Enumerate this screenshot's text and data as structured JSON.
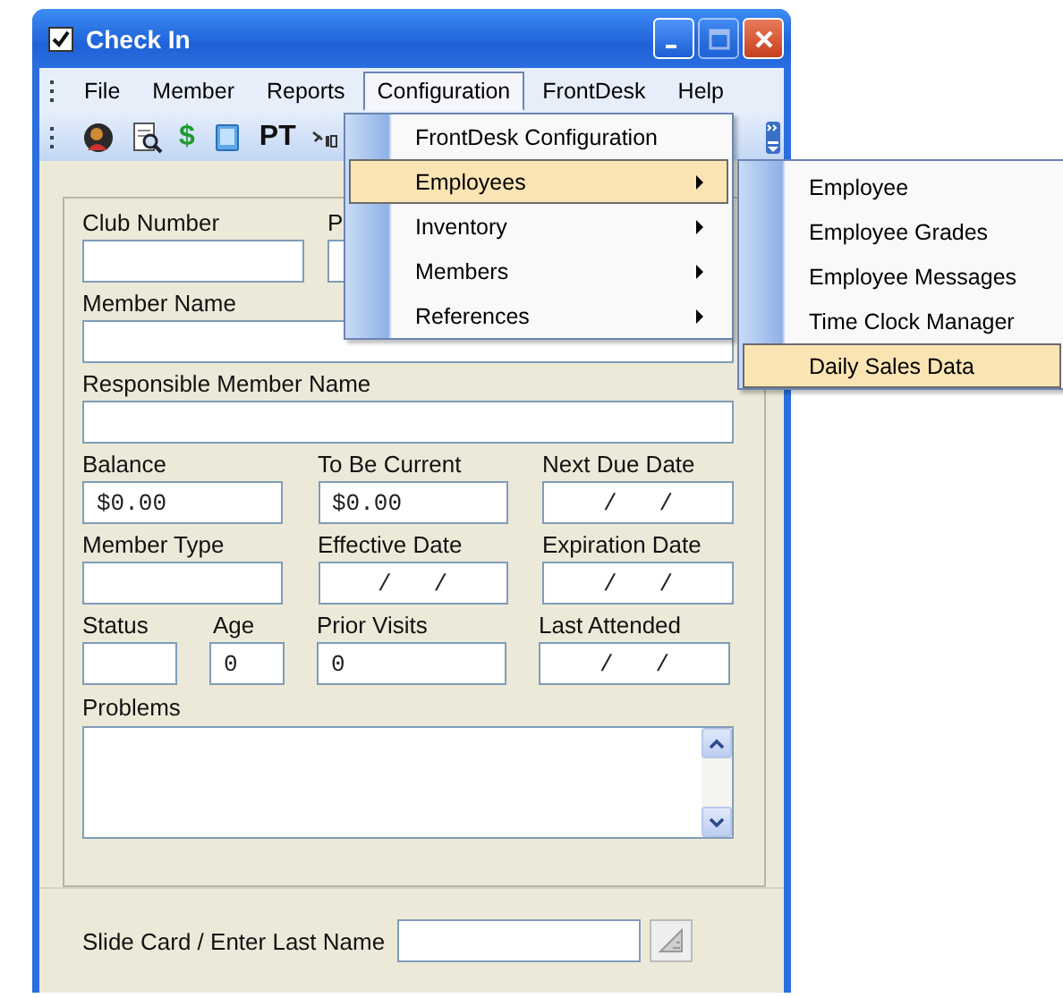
{
  "window": {
    "title": "Check In",
    "buttons": [
      {
        "kind": "minimize",
        "disabled": false
      },
      {
        "kind": "maximize",
        "disabled": true
      },
      {
        "kind": "close",
        "disabled": false
      }
    ]
  },
  "menu_bar": [
    {
      "label": "File",
      "selected": false
    },
    {
      "label": "Member",
      "selected": false
    },
    {
      "label": "Reports",
      "selected": false
    },
    {
      "label": "Configuration",
      "selected": true
    },
    {
      "label": "FrontDesk",
      "selected": false
    },
    {
      "label": "Help",
      "selected": false
    }
  ],
  "toolbar": [
    {
      "kind": "person"
    },
    {
      "kind": "document-search"
    },
    {
      "kind": "text",
      "label": "$",
      "color": "#1f9a2e"
    },
    {
      "kind": "document"
    },
    {
      "kind": "text",
      "label": "PT",
      "color": "#111111"
    },
    {
      "kind": "small"
    }
  ],
  "form_rows": [
    [
      {
        "label": "Club Number"
      },
      {
        "label": "P"
      }
    ],
    [
      {
        "label": "Member Name"
      }
    ],
    [
      {
        "label": "Responsible Member Name"
      }
    ],
    [
      {
        "label": "Balance",
        "value": "$0.00"
      },
      {
        "label": "To Be Current",
        "value": "$0.00"
      },
      {
        "label": "Next Due Date",
        "value": "/   /",
        "kind": "date"
      }
    ],
    [
      {
        "label": "Member Type"
      },
      {
        "label": "Effective Date",
        "value": "/   /",
        "kind": "date"
      },
      {
        "label": "Expiration Date",
        "value": "/   /",
        "kind": "date"
      }
    ],
    [
      {
        "label": "Status"
      },
      {
        "label": "Age",
        "value": "0"
      },
      {
        "label": "Prior Visits",
        "value": "0"
      },
      {
        "label": "Last Attended",
        "value": "/   /",
        "kind": "date"
      }
    ]
  ],
  "problems": {
    "label": "Problems"
  },
  "card_entry": {
    "label": "Slide Card / Enter Last Name"
  },
  "configuration_menu": [
    {
      "label": "FrontDesk Configuration",
      "submenu": false,
      "selected": false
    },
    {
      "label": "Employees",
      "submenu": true,
      "selected": true
    },
    {
      "label": "Inventory",
      "submenu": true,
      "selected": false
    },
    {
      "label": "Members",
      "submenu": true,
      "selected": false
    },
    {
      "label": "References",
      "submenu": true,
      "selected": false
    }
  ],
  "employees_submenu": [
    {
      "label": "Employee",
      "selected": false
    },
    {
      "label": "Employee Grades",
      "selected": false
    },
    {
      "label": "Employee Messages",
      "selected": false
    },
    {
      "label": "Time Clock Manager",
      "selected": false
    },
    {
      "label": "Daily Sales Data",
      "selected": true
    }
  ]
}
